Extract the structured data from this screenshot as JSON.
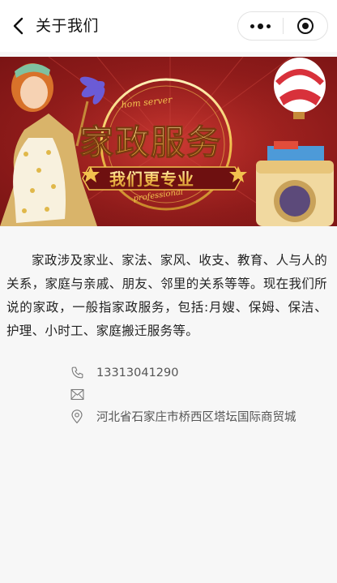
{
  "navbar": {
    "title": "关于我们",
    "back_icon": "chevron-left-icon",
    "more_icon": "more-dots-icon",
    "close_icon": "target-circle-icon"
  },
  "banner": {
    "arc_top_text": "hom server",
    "main_text": "家政服务",
    "sub_text": "我们更专业",
    "arc_bottom_text": "professional",
    "colors": {
      "background": "#8e1b1a",
      "gold": "#f2c14e"
    }
  },
  "intro": {
    "text": "家政涉及家业、家法、家风、收支、教育、人与人的关系，家庭与亲戚、朋友、邻里的关系等等。现在我们所说的家政，一般指家政服务，包括:月嫂、保姆、保洁、护理、小时工、家庭搬迁服务等。"
  },
  "contact": {
    "phone": "13313041290",
    "email": "",
    "address": "河北省石家庄市桥西区塔坛国际商贸城",
    "icons": [
      "phone-icon",
      "mail-icon",
      "location-icon"
    ]
  }
}
